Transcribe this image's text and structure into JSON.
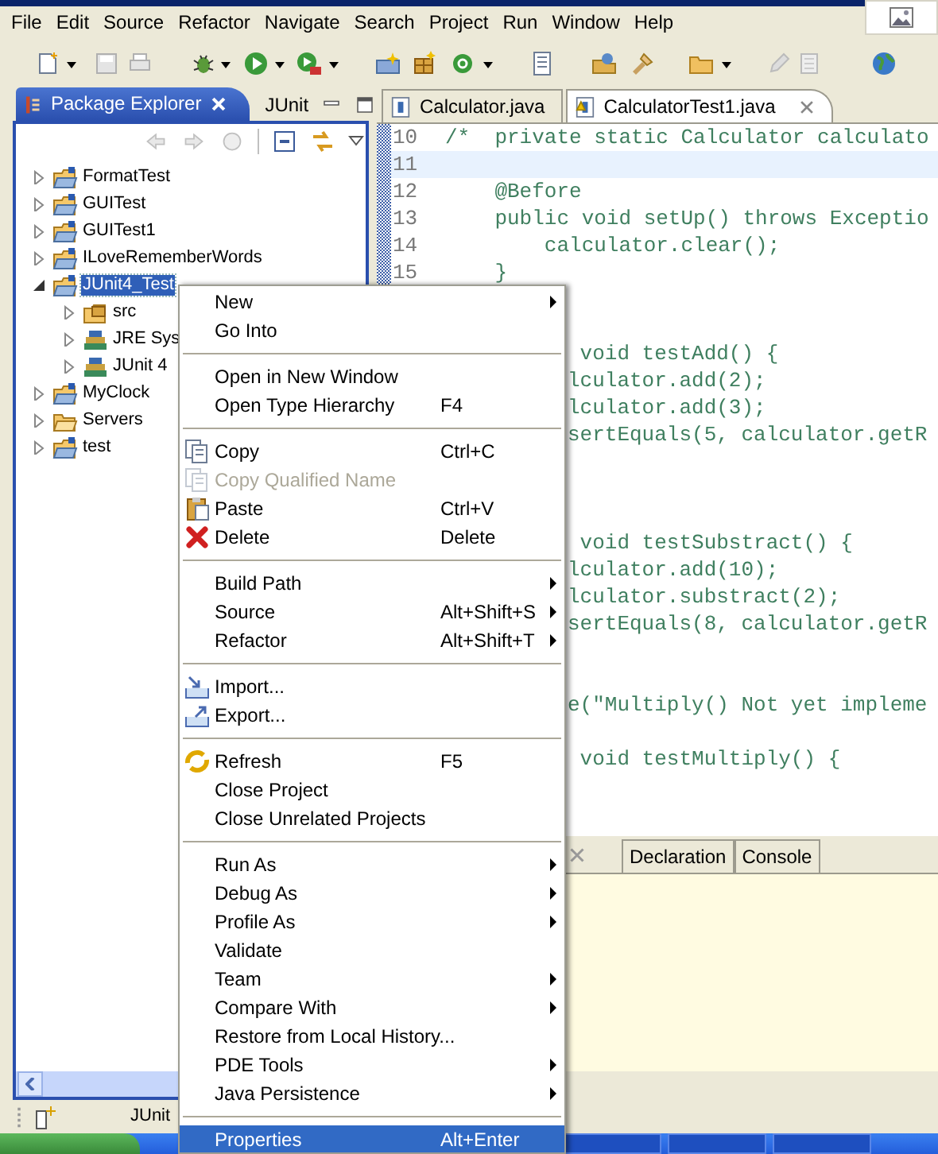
{
  "menu_bar": [
    "File",
    "Edit",
    "Source",
    "Refactor",
    "Navigate",
    "Search",
    "Project",
    "Run",
    "Window",
    "Help"
  ],
  "package_explorer": {
    "tabs": [
      {
        "label": "Package Explorer",
        "selected": true
      },
      {
        "label": "JUnit",
        "selected": false
      }
    ],
    "tree": [
      {
        "label": "FormatTest",
        "kind": "project",
        "expanded": false,
        "selected": false
      },
      {
        "label": "GUITest",
        "kind": "project",
        "expanded": false,
        "selected": false
      },
      {
        "label": "GUITest1",
        "kind": "project",
        "expanded": false,
        "selected": false
      },
      {
        "label": "ILoveRememberWords",
        "kind": "project",
        "expanded": false,
        "selected": false
      },
      {
        "label": "JUnit4_Test",
        "kind": "project",
        "expanded": true,
        "selected": true,
        "children": [
          {
            "label": "src",
            "kind": "source",
            "expanded": false,
            "selected": false
          },
          {
            "label": "JRE Sys",
            "kind": "library",
            "expanded": false,
            "selected": false
          },
          {
            "label": "JUnit 4",
            "kind": "library",
            "expanded": false,
            "selected": false
          }
        ]
      },
      {
        "label": "MyClock",
        "kind": "project",
        "expanded": false,
        "selected": false
      },
      {
        "label": "Servers",
        "kind": "folder",
        "expanded": false,
        "selected": false
      },
      {
        "label": "test",
        "kind": "project",
        "expanded": false,
        "selected": false
      }
    ]
  },
  "editor": {
    "tabs": [
      {
        "label": "Calculator.java",
        "selected": false
      },
      {
        "label": "CalculatorTest1.java",
        "selected": true
      }
    ],
    "lines": [
      {
        "number": "10",
        "text": "/*  private static Calculator calculato",
        "current": false
      },
      {
        "number": "11",
        "current": true
      },
      {
        "number": "12",
        "text": "    @Before",
        "current": false
      },
      {
        "number": "13",
        "text": "    public void setUp() throws Exceptio",
        "current": false
      },
      {
        "number": "14",
        "text": "        calculator.clear();",
        "current": false
      },
      {
        "number": "15",
        "text": "    }",
        "current": false
      }
    ],
    "fragments": [
      " void testAdd() {",
      "lculator.add(2);",
      "lculator.add(3);",
      "sertEquals(5, calculator.getR",
      " void testSubstract() {",
      "lculator.add(10);",
      "lculator.substract(2);",
      "sertEquals(8, calculator.getR",
      "e(\"Multiply() Not yet impleme",
      " void testMultiply() {"
    ]
  },
  "bottom_panel": {
    "tabs": [
      "Declaration",
      "Console"
    ]
  },
  "status_bar": {
    "label": "JUnit"
  },
  "context_menu": {
    "groups": [
      [
        {
          "label": "New",
          "kind": "plain",
          "submenu": true,
          "disabled": false,
          "selected": false
        },
        {
          "label": "Go Into",
          "kind": "plain",
          "submenu": false,
          "disabled": false,
          "selected": false
        }
      ],
      [
        {
          "label": "Open in New Window",
          "kind": "plain",
          "submenu": false,
          "disabled": false,
          "selected": false
        },
        {
          "label": "Open Type Hierarchy",
          "shortcut": "F4",
          "kind": "plain",
          "submenu": false,
          "disabled": false,
          "selected": false
        }
      ],
      [
        {
          "label": "Copy",
          "shortcut": "Ctrl+C",
          "kind": "copy",
          "submenu": false,
          "disabled": false,
          "selected": false
        },
        {
          "label": "Copy Qualified Name",
          "kind": "copy",
          "submenu": false,
          "disabled": true,
          "selected": false
        },
        {
          "label": "Paste",
          "shortcut": "Ctrl+V",
          "kind": "paste",
          "submenu": false,
          "disabled": false,
          "selected": false
        },
        {
          "label": "Delete",
          "shortcut": "Delete",
          "kind": "delete",
          "submenu": false,
          "disabled": false,
          "selected": false
        }
      ],
      [
        {
          "label": "Build Path",
          "kind": "plain",
          "submenu": true,
          "disabled": false,
          "selected": false
        },
        {
          "label": "Source",
          "shortcut": "Alt+Shift+S",
          "kind": "plain",
          "submenu": true,
          "disabled": false,
          "selected": false
        },
        {
          "label": "Refactor",
          "shortcut": "Alt+Shift+T",
          "kind": "plain",
          "submenu": true,
          "disabled": false,
          "selected": false
        }
      ],
      [
        {
          "label": "Import...",
          "kind": "import",
          "submenu": false,
          "disabled": false,
          "selected": false
        },
        {
          "label": "Export...",
          "kind": "export",
          "submenu": false,
          "disabled": false,
          "selected": false
        }
      ],
      [
        {
          "label": "Refresh",
          "shortcut": "F5",
          "kind": "refresh",
          "submenu": false,
          "disabled": false,
          "selected": false
        },
        {
          "label": "Close Project",
          "kind": "plain",
          "submenu": false,
          "disabled": false,
          "selected": false
        },
        {
          "label": "Close Unrelated Projects",
          "kind": "plain",
          "submenu": false,
          "disabled": false,
          "selected": false
        }
      ],
      [
        {
          "label": "Run As",
          "kind": "plain",
          "submenu": true,
          "disabled": false,
          "selected": false
        },
        {
          "label": "Debug As",
          "kind": "plain",
          "submenu": true,
          "disabled": false,
          "selected": false
        },
        {
          "label": "Profile As",
          "kind": "plain",
          "submenu": true,
          "disabled": false,
          "selected": false
        },
        {
          "label": "Validate",
          "kind": "plain",
          "submenu": false,
          "disabled": false,
          "selected": false
        },
        {
          "label": "Team",
          "kind": "plain",
          "submenu": true,
          "disabled": false,
          "selected": false
        },
        {
          "label": "Compare With",
          "kind": "plain",
          "submenu": true,
          "disabled": false,
          "selected": false
        },
        {
          "label": "Restore from Local History...",
          "kind": "plain",
          "submenu": false,
          "disabled": false,
          "selected": false
        },
        {
          "label": "PDE Tools",
          "kind": "plain",
          "submenu": true,
          "disabled": false,
          "selected": false
        },
        {
          "label": "Java Persistence",
          "kind": "plain",
          "submenu": true,
          "disabled": false,
          "selected": false
        }
      ],
      [
        {
          "label": "Properties",
          "shortcut": "Alt+Enter",
          "kind": "plain",
          "submenu": false,
          "disabled": false,
          "selected": true
        }
      ]
    ]
  }
}
